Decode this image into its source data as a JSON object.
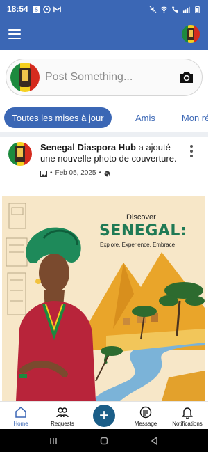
{
  "status_bar": {
    "time": "18:54",
    "battery": "",
    "accent": "#3b67b5"
  },
  "composer": {
    "placeholder": "Post Something..."
  },
  "tabs": [
    {
      "label": "Toutes les mises à jour",
      "active": true
    },
    {
      "label": "Amis",
      "active": false
    },
    {
      "label": "Mon réseau",
      "active": false
    }
  ],
  "post": {
    "author": "Senegal Diaspora  Hub",
    "action": " a ajouté une nouvelle photo de couverture.",
    "date": "Feb 05, 2025",
    "image": {
      "kicker": "Discover",
      "title": "SENEGAL:",
      "subtitle": "Explore, Experience, Embrace"
    }
  },
  "bottom_nav": {
    "home": "Home",
    "requests": "Requests",
    "message": "Message",
    "notifications": "Notifications",
    "fab_icon": "plus-icon"
  },
  "colors": {
    "primary": "#3b67b5",
    "fab": "#1b5e88",
    "title_green": "#1f7a55"
  }
}
